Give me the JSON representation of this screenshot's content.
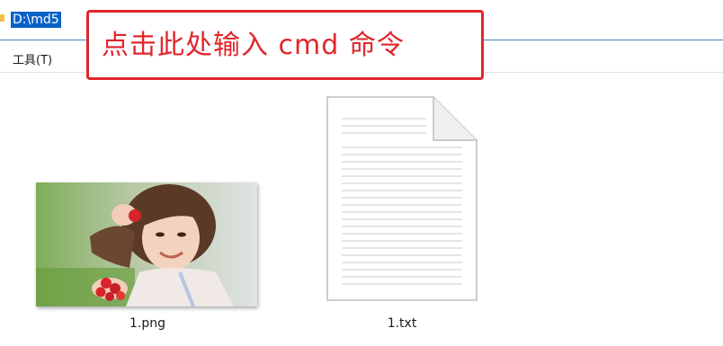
{
  "address_bar": {
    "path": "D:\\md5"
  },
  "menu": {
    "tools_label": "工具(T)"
  },
  "annotation": {
    "text": "点击此处输入  cmd 命令",
    "color": "#e0262b"
  },
  "files": [
    {
      "name": "1.png",
      "icon": "image-thumbnail"
    },
    {
      "name": "1.txt",
      "icon": "text-document-icon"
    }
  ],
  "colors": {
    "selection": "#0a62c8",
    "address_border": "#3e88c8"
  }
}
